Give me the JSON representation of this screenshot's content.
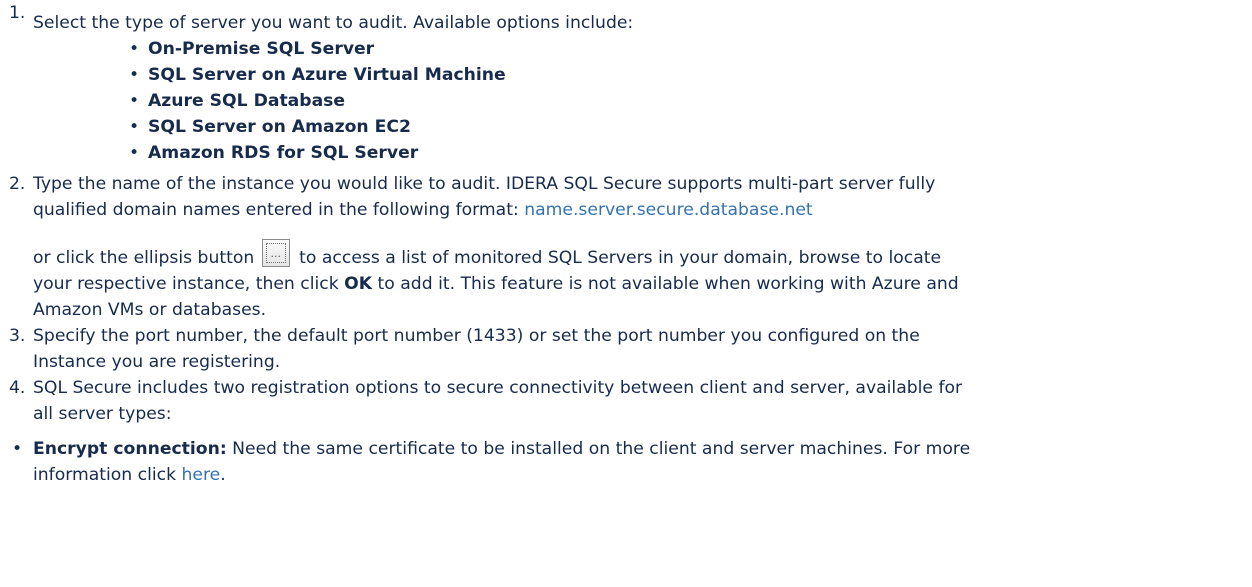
{
  "steps": [
    {
      "number": "1.",
      "text": "Select the type of server you want to audit. Available options include:",
      "options": [
        "On-Premise SQL Server",
        "SQL Server on Azure Virtual Machine",
        "Azure SQL Database",
        "SQL Server on Amazon EC2",
        "Amazon RDS for SQL Server"
      ]
    },
    {
      "number": "2.",
      "text_line1": "Type the name of the instance you would like to audit. IDERA SQL Secure supports multi-part server fully",
      "text_line2": "qualified domain names entered in the following format: ",
      "format_link": "name.server.secure.database.net",
      "cont_before_button": "or click the ellipsis button",
      "ellipsis_button_icon": "ellipsis-button-icon",
      "ellipsis_button_glyph": "...",
      "cont_after_button": " to access a list of monitored SQL Servers in your domain, browse to locate",
      "cont_line2_pre": "your respective instance, then click ",
      "cont_ok": "OK",
      "cont_line2_post": " to add it. This feature is not available when working with Azure and",
      "cont_line3": "Amazon VMs or databases."
    },
    {
      "number": "3.",
      "text_line1": "Specify the port number, the default port number (1433) or set the port number you configured on the",
      "text_line2": "Instance you are registering."
    },
    {
      "number": "4.",
      "text_line1": "SQL Secure includes two registration options to secure connectivity between client and server, available for",
      "text_line2": "all server types:"
    }
  ],
  "encrypt": {
    "label": "Encrypt connection:",
    "text_line1": " Need the same certificate to be installed on the client and server machines. For more",
    "text_line2": "information click ",
    "link": "here",
    "period": "."
  },
  "colors": {
    "text": "#172b4d",
    "link": "#3572b0"
  }
}
